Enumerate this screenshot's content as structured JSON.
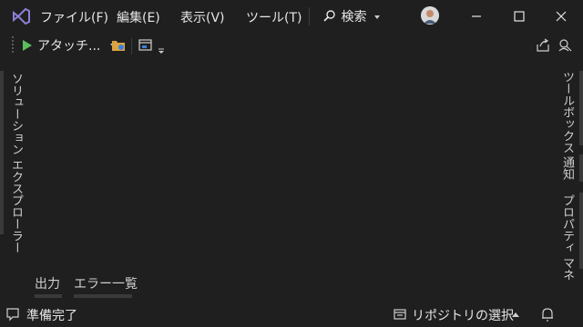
{
  "menu": {
    "file": "ファイル(F)",
    "edit": "編集(E)",
    "view": "表示(V)",
    "tools": "ツール(T)"
  },
  "search": {
    "label": "検索"
  },
  "toolbar": {
    "attach_label": "アタッチ..."
  },
  "left_panel": {
    "solution_explorer": "ソリューション エクスプローラー"
  },
  "right_panel": {
    "toolbox": "ツールボックス",
    "notifications": "通知",
    "properties": "プロパティ マネ"
  },
  "bottom_tabs": {
    "output": "出力",
    "error_list": "エラー一覧"
  },
  "status": {
    "ready": "準備完了",
    "repo_select": "リポジトリの選択"
  },
  "colors": {
    "background": "#1f1f1f",
    "logo": "#8f7fd6",
    "play": "#5bbf5b"
  },
  "icons": [
    "vs-logo-icon",
    "search-icon",
    "avatar",
    "minimize-icon",
    "maximize-icon",
    "close-icon",
    "play-icon",
    "folder-icon",
    "window-icon",
    "share-icon",
    "feedback-icon",
    "status-window-icon",
    "repo-icon",
    "bell-icon"
  ]
}
